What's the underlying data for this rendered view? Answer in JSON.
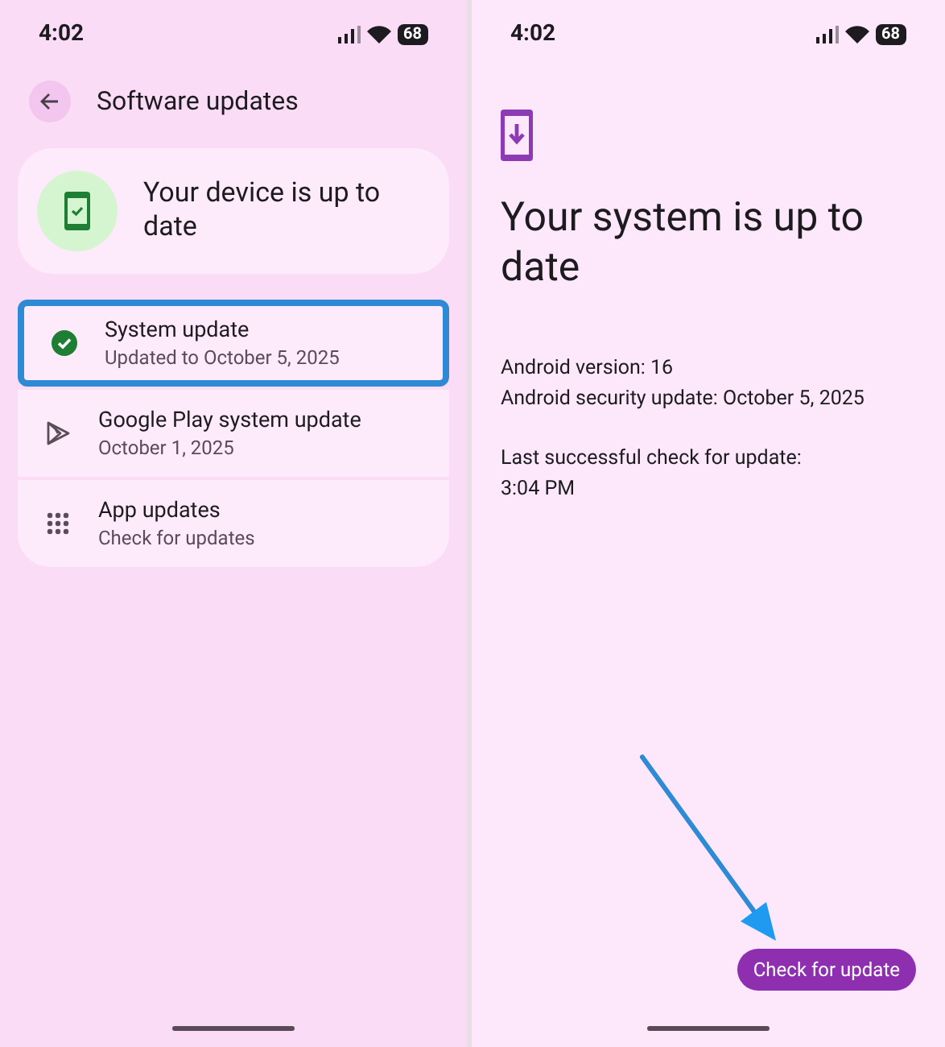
{
  "left_screen": {
    "status_bar": {
      "time": "4:02",
      "battery": "68"
    },
    "header": {
      "title": "Software updates"
    },
    "status_card": {
      "title": "Your device is up to date"
    },
    "items": [
      {
        "kind": "check",
        "title": "System update",
        "subtitle": "Updated to October 5, 2025",
        "highlighted": true
      },
      {
        "kind": "play",
        "title": "Google Play system update",
        "subtitle": "October 1, 2025",
        "highlighted": false
      },
      {
        "kind": "grid",
        "title": "App updates",
        "subtitle": "Check for updates",
        "highlighted": false
      }
    ]
  },
  "right_screen": {
    "status_bar": {
      "time": "4:02",
      "battery": "68"
    },
    "title": "Your system is up to date",
    "details": [
      "Android version: 16",
      "Android security update: October 5, 2025"
    ],
    "last_check": [
      "Last successful check for update:",
      "3:04 PM"
    ],
    "button": "Check for update"
  }
}
